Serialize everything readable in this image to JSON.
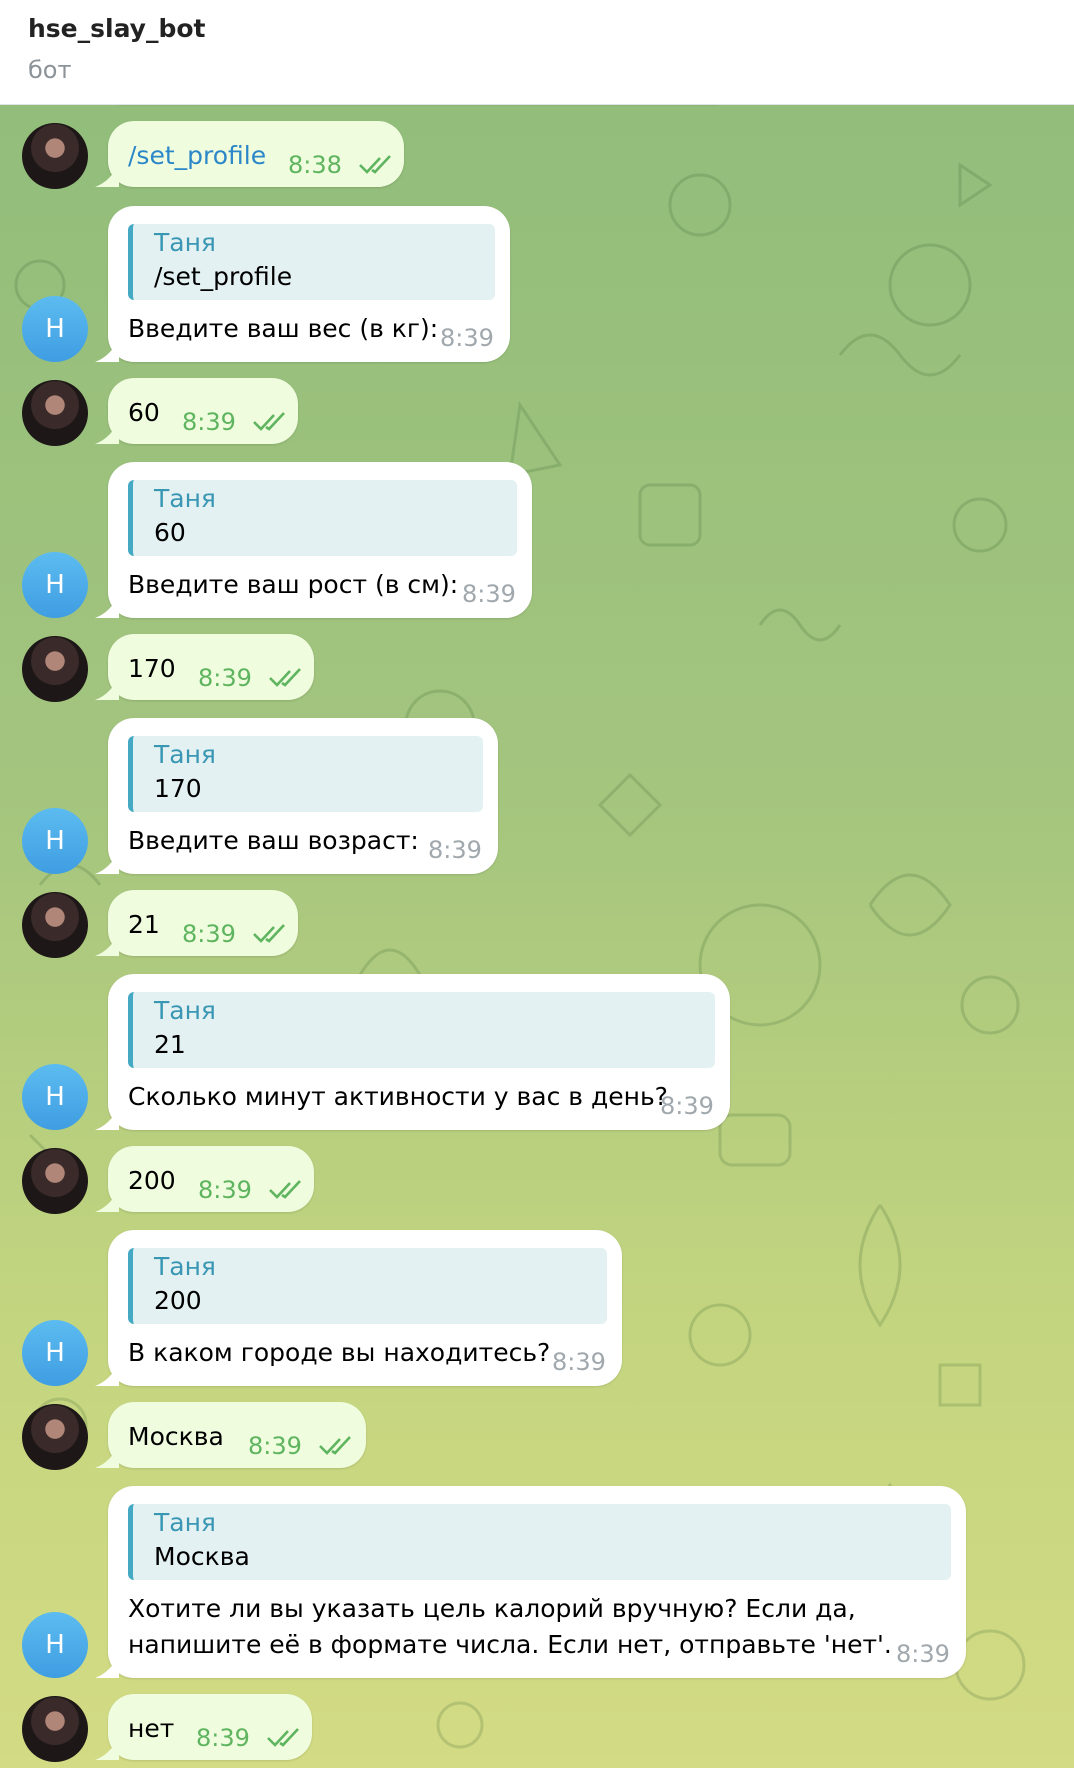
{
  "header": {
    "title": "hse_slay_bot",
    "status": "бот"
  },
  "bot_avatar_letter": "H",
  "messages": [
    {
      "from": "user",
      "text": "/set_profile",
      "time": "8:38",
      "is_command": true
    },
    {
      "from": "bot",
      "reply_name": "Таня",
      "reply_text": "/set_profile",
      "text": "Введите ваш вес (в кг):",
      "time": "8:39"
    },
    {
      "from": "user",
      "text": "60",
      "time": "8:39"
    },
    {
      "from": "bot",
      "reply_name": "Таня",
      "reply_text": "60",
      "text": "Введите ваш рост (в см):",
      "time": "8:39"
    },
    {
      "from": "user",
      "text": "170",
      "time": "8:39"
    },
    {
      "from": "bot",
      "reply_name": "Таня",
      "reply_text": "170",
      "text": "Введите ваш возраст:",
      "time": "8:39"
    },
    {
      "from": "user",
      "text": "21",
      "time": "8:39"
    },
    {
      "from": "bot",
      "reply_name": "Таня",
      "reply_text": "21",
      "text": "Сколько минут активности у вас в день?",
      "time": "8:39"
    },
    {
      "from": "user",
      "text": "200",
      "time": "8:39"
    },
    {
      "from": "bot",
      "reply_name": "Таня",
      "reply_text": "200",
      "text": "В каком городе вы находитесь?",
      "time": "8:39"
    },
    {
      "from": "user",
      "text": "Москва",
      "time": "8:39"
    },
    {
      "from": "bot",
      "reply_name": "Таня",
      "reply_text": "Москва",
      "text_line1": "Хотите ли вы указать цель калорий вручную? Если да,",
      "text_line2": "напишите её в формате числа. Если нет, отправьте 'нет'.",
      "time": "8:39"
    },
    {
      "from": "user",
      "text": "нет",
      "time": "8:39"
    }
  ],
  "colors": {
    "outgoing_bubble": "#effdde",
    "incoming_bubble": "#ffffff",
    "checkmarks": "#5fb45f",
    "reply_accent": "#45a9c4",
    "bot_avatar": "#4aa8e8"
  },
  "icons": {
    "read_status": "double-check-icon",
    "bubble_tail": "bubble-tail-icon"
  }
}
